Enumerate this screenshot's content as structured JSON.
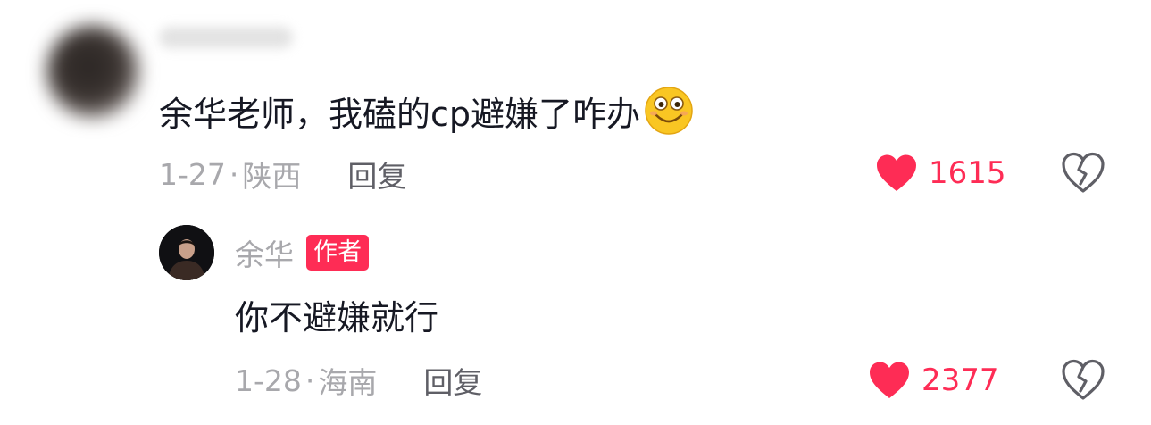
{
  "comment": {
    "text": "余华老师，我磕的cp避嫌了咋办",
    "emoji": "smile-emoji",
    "date": "1-27",
    "separator": "·",
    "location": "陕西",
    "reply_label": "回复",
    "like_count": "1615"
  },
  "reply": {
    "author_name": "余华",
    "author_badge": "作者",
    "text": "你不避嫌就行",
    "date": "1-28",
    "separator": "·",
    "location": "海南",
    "reply_label": "回复",
    "like_count": "2377"
  },
  "icons": {
    "like": "heart-icon",
    "dislike": "broken-heart-icon"
  },
  "colors": {
    "accent": "#fe2c55",
    "text_primary": "#161823",
    "text_secondary": "#a8a8ac",
    "reply_label": "#5f5f66",
    "icon_outline": "#5f5f66"
  }
}
